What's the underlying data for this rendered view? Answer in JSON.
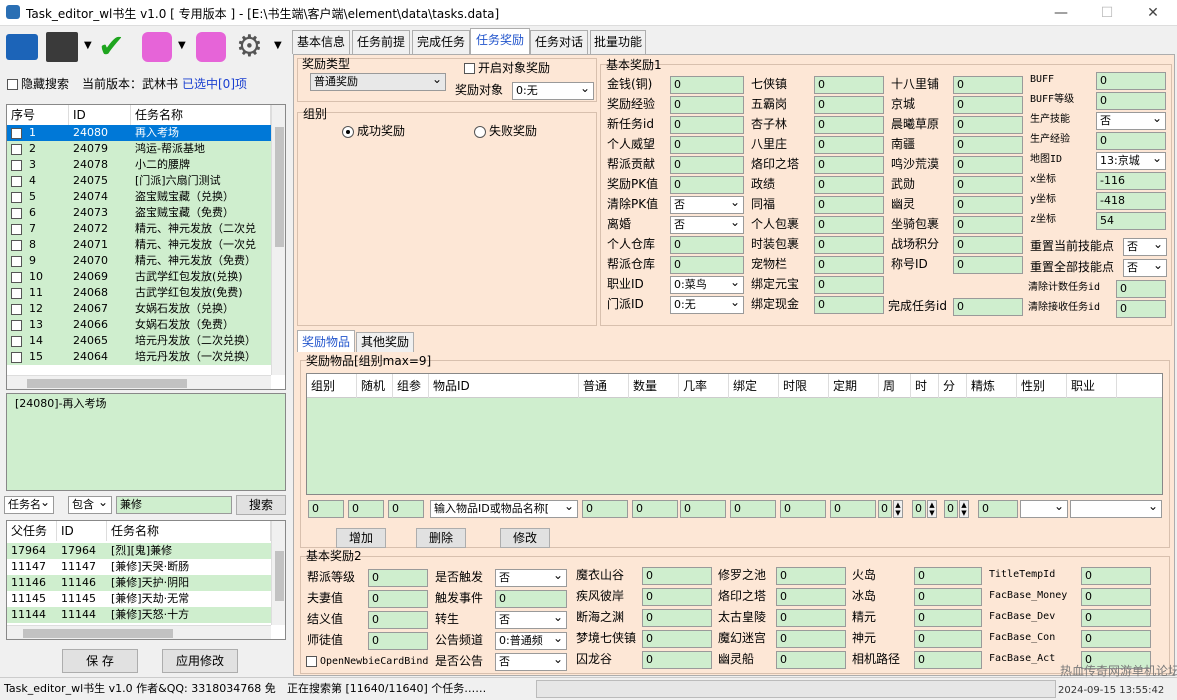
{
  "window": {
    "title": "Task_editor_wl书生 v1.0 [ 专用版本 ] - [E:\\书生端\\客户端\\element\\data\\tasks.data]"
  },
  "toolbar": {
    "hide_search": "隐藏搜索",
    "version_label": "当前版本：武林书",
    "selected": "已选中[0]项"
  },
  "task_list": {
    "headers": [
      "序号",
      "ID",
      "任务名称"
    ],
    "rows": [
      {
        "n": "1",
        "id": "24080",
        "name": "再入考场"
      },
      {
        "n": "2",
        "id": "24079",
        "name": "鸿运-帮派基地"
      },
      {
        "n": "3",
        "id": "24078",
        "name": "小二的腰牌"
      },
      {
        "n": "4",
        "id": "24075",
        "name": "[门派]六扇门测试"
      },
      {
        "n": "5",
        "id": "24074",
        "name": "盗宝贼宝藏（兑换）"
      },
      {
        "n": "6",
        "id": "24073",
        "name": "盗宝贼宝藏（免费）"
      },
      {
        "n": "7",
        "id": "24072",
        "name": "精元、神元发放（二次兑"
      },
      {
        "n": "8",
        "id": "24071",
        "name": "精元、神元发放（一次兑"
      },
      {
        "n": "9",
        "id": "24070",
        "name": "精元、神元发放（免费）"
      },
      {
        "n": "10",
        "id": "24069",
        "name": "古武学红包发放(兑换)"
      },
      {
        "n": "11",
        "id": "24068",
        "name": "古武学红包发放(免费)"
      },
      {
        "n": "12",
        "id": "24067",
        "name": "女娲石发放（兑换）"
      },
      {
        "n": "13",
        "id": "24066",
        "name": "女娲石发放（免费）"
      },
      {
        "n": "14",
        "id": "24065",
        "name": "培元丹发放（二次兑换）"
      },
      {
        "n": "15",
        "id": "24064",
        "name": "培元丹发放（一次兑换）"
      }
    ]
  },
  "tree": {
    "item": "[24080]-再入考场"
  },
  "search": {
    "mode": "任务名",
    "match": "包含",
    "value": "兼修",
    "button": "搜索"
  },
  "parent_list": {
    "headers": [
      "父任务",
      "ID",
      "任务名称"
    ],
    "rows": [
      {
        "p": "17964",
        "id": "17964",
        "name": "[烈][鬼]兼修"
      },
      {
        "p": "11147",
        "id": "11147",
        "name": "[兼修]天哭·断肠"
      },
      {
        "p": "11146",
        "id": "11146",
        "name": "[兼修]天护·阴阳"
      },
      {
        "p": "11145",
        "id": "11145",
        "name": "[兼修]天劫·无常"
      },
      {
        "p": "11144",
        "id": "11144",
        "name": "[兼修]天怒·十方"
      }
    ]
  },
  "buttons": {
    "save": "保 存",
    "apply": "应用修改",
    "add": "增加",
    "delete": "删除",
    "modify": "修改"
  },
  "tabs": [
    "基本信息",
    "任务前提",
    "完成任务",
    "任务奖励",
    "任务对话",
    "批量功能"
  ],
  "reward_type": {
    "label": "奖励类型",
    "value": "普通奖励",
    "open_obj": "开启对象奖励",
    "obj_label": "奖励对象",
    "obj_value": "0:无"
  },
  "group": {
    "label": "组别",
    "success": "成功奖励",
    "fail": "失败奖励"
  },
  "basic1": {
    "title": "基本奖励1",
    "col1": [
      {
        "l": "金钱(铜)",
        "v": "0"
      },
      {
        "l": "奖励经验",
        "v": "0"
      },
      {
        "l": "新任务id",
        "v": "0"
      },
      {
        "l": "个人威望",
        "v": "0"
      },
      {
        "l": "帮派贡献",
        "v": "0"
      },
      {
        "l": "奖励PK值",
        "v": "0"
      },
      {
        "l": "清除PK值",
        "v": "否"
      },
      {
        "l": "离婚",
        "v": "否"
      },
      {
        "l": "个人仓库",
        "v": "0"
      },
      {
        "l": "帮派仓库",
        "v": "0"
      },
      {
        "l": "职业ID",
        "v": "0:菜鸟"
      },
      {
        "l": "门派ID",
        "v": "0:无"
      }
    ],
    "col2": [
      {
        "l": "七侠镇",
        "v": "0"
      },
      {
        "l": "五霸岗",
        "v": "0"
      },
      {
        "l": "杏子林",
        "v": "0"
      },
      {
        "l": "八里庄",
        "v": "0"
      },
      {
        "l": "烙印之塔",
        "v": "0"
      },
      {
        "l": "政绩",
        "v": "0"
      },
      {
        "l": "同福",
        "v": "0"
      },
      {
        "l": "个人包裹",
        "v": "0"
      },
      {
        "l": "时装包裹",
        "v": "0"
      },
      {
        "l": "宠物栏",
        "v": "0"
      },
      {
        "l": "绑定元宝",
        "v": "0"
      },
      {
        "l": "绑定现金",
        "v": "0"
      }
    ],
    "col3": [
      {
        "l": "十八里铺",
        "v": "0"
      },
      {
        "l": "京城",
        "v": "0"
      },
      {
        "l": "晨曦草原",
        "v": "0"
      },
      {
        "l": "南疆",
        "v": "0"
      },
      {
        "l": "鸣沙荒漠",
        "v": "0"
      },
      {
        "l": "武勋",
        "v": "0"
      },
      {
        "l": "幽灵",
        "v": "0"
      },
      {
        "l": "坐骑包裹",
        "v": "0"
      },
      {
        "l": "战场积分",
        "v": "0"
      },
      {
        "l": "称号ID",
        "v": "0"
      }
    ],
    "done_task": {
      "l": "完成任务id",
      "v": "0"
    },
    "col4": [
      {
        "l": "BUFF",
        "v": "0"
      },
      {
        "l": "BUFF等级",
        "v": "0"
      },
      {
        "l": "生产技能",
        "v": "否"
      },
      {
        "l": "生产经验",
        "v": "0"
      },
      {
        "l": "地图ID",
        "v": "13:京城"
      },
      {
        "l": "x坐标",
        "v": "-116"
      },
      {
        "l": "y坐标",
        "v": "-418"
      },
      {
        "l": "z坐标",
        "v": "54"
      }
    ],
    "reset_skill": {
      "l": "重置当前技能点",
      "v": "否"
    },
    "reset_all": {
      "l": "重置全部技能点",
      "v": "否"
    },
    "clear_count": {
      "l": "清除计数任务id",
      "v": "0"
    },
    "clear_recv": {
      "l": "清除接收任务id",
      "v": "0"
    }
  },
  "subtabs": [
    "奖励物品",
    "其他奖励"
  ],
  "items": {
    "title": "奖励物品[组别max=9]",
    "headers": [
      "组别",
      "随机",
      "组参",
      "物品ID",
      "普通",
      "数量",
      "几率",
      "绑定",
      "时限",
      "定期",
      "周",
      "时",
      "分",
      "精炼",
      "性别",
      "职业"
    ],
    "inputs": {
      "a": "0",
      "b": "0",
      "c": "0",
      "item": "输入物品ID或物品名称[",
      "d": "0",
      "e": "0",
      "f": "0",
      "g": "0",
      "h": "0",
      "i": "0",
      "j": "0",
      "k": "0",
      "l": "0",
      "m": "0"
    }
  },
  "basic2": {
    "title": "基本奖励2",
    "c1": [
      {
        "l": "帮派等级",
        "v": "0"
      },
      {
        "l": "夫妻值",
        "v": "0"
      },
      {
        "l": "结义值",
        "v": "0"
      },
      {
        "l": "师徒值",
        "v": "0"
      }
    ],
    "c2": [
      {
        "l": "是否触发",
        "v": "否"
      },
      {
        "l": "触发事件",
        "v": "0"
      },
      {
        "l": "转生",
        "v": "否"
      },
      {
        "l": "公告频道",
        "v": "0:普通频"
      },
      {
        "l": "是否公告",
        "v": "否"
      }
    ],
    "c3": [
      {
        "l": "魔衣山谷",
        "v": "0"
      },
      {
        "l": "疾风彼岸",
        "v": "0"
      },
      {
        "l": "断海之渊",
        "v": "0"
      },
      {
        "l": "梦境七侠镇",
        "v": "0"
      },
      {
        "l": "囚龙谷",
        "v": "0"
      }
    ],
    "c4": [
      {
        "l": "修罗之池",
        "v": "0"
      },
      {
        "l": "烙印之塔",
        "v": "0"
      },
      {
        "l": "太古皇陵",
        "v": "0"
      },
      {
        "l": "魔幻迷宫",
        "v": "0"
      },
      {
        "l": "幽灵船",
        "v": "0"
      }
    ],
    "c5": [
      {
        "l": "火岛",
        "v": "0"
      },
      {
        "l": "冰岛",
        "v": "0"
      },
      {
        "l": "精元",
        "v": "0"
      },
      {
        "l": "神元",
        "v": "0"
      },
      {
        "l": "相机路径",
        "v": "0"
      }
    ],
    "c6": [
      {
        "l": "TitleTempId",
        "v": "0"
      },
      {
        "l": "FacBase_Money",
        "v": "0"
      },
      {
        "l": "FacBase_Dev",
        "v": "0"
      },
      {
        "l": "FacBase_Con",
        "v": "0"
      },
      {
        "l": "FacBase_Act",
        "v": "0"
      }
    ],
    "newbie": "OpenNewbieCardBind"
  },
  "status": {
    "left": "Task_editor_wl书生 v1.0 作者&QQ: 3318034768 免",
    "mid": "正在搜索第 [11640/11640] 个任务……",
    "right": "2024-09-15 13:55:42"
  },
  "watermark": "热血传奇网游单机论坛"
}
